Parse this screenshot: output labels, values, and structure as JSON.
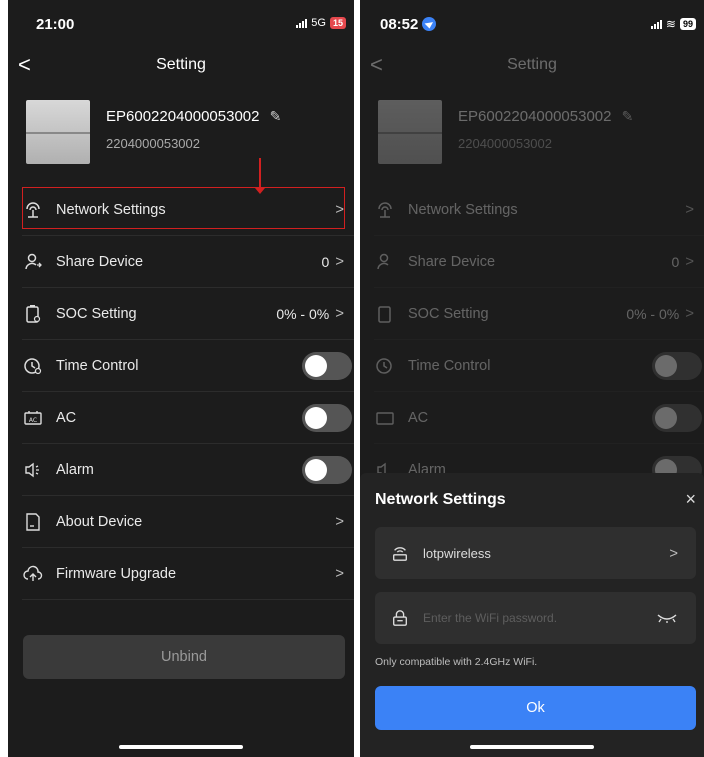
{
  "left": {
    "status": {
      "time": "21:00",
      "network": "5G",
      "battery": "15"
    },
    "nav": {
      "title": "Setting",
      "back": "<"
    },
    "device": {
      "name": "EP6002204000053002",
      "serial": "2204000053002"
    },
    "rows": [
      {
        "label": "Network Settings",
        "value": "",
        "type": "chevron"
      },
      {
        "label": "Share Device",
        "value": "0",
        "type": "chevron"
      },
      {
        "label": "SOC Setting",
        "value": "0% - 0%",
        "type": "chevron"
      },
      {
        "label": "Time Control",
        "value": "",
        "type": "toggle"
      },
      {
        "label": "AC",
        "value": "",
        "type": "toggle"
      },
      {
        "label": "Alarm",
        "value": "",
        "type": "toggle"
      },
      {
        "label": "About Device",
        "value": "",
        "type": "chevron"
      },
      {
        "label": "Firmware Upgrade",
        "value": "",
        "type": "chevron"
      }
    ],
    "unbind": "Unbind",
    "chevron": ">"
  },
  "right": {
    "status": {
      "time": "08:52",
      "battery": "99"
    },
    "nav": {
      "title": "Setting",
      "back": "<"
    },
    "device": {
      "name": "EP6002204000053002",
      "serial": "2204000053002"
    },
    "rows": [
      {
        "label": "Network Settings",
        "value": ""
      },
      {
        "label": "Share Device",
        "value": "0"
      },
      {
        "label": "SOC Setting",
        "value": "0% - 0%"
      },
      {
        "label": "Time Control",
        "value": ""
      },
      {
        "label": "AC",
        "value": ""
      },
      {
        "label": "Alarm",
        "value": ""
      }
    ],
    "sheet": {
      "title": "Network Settings",
      "close": "×",
      "wifi_name": "lotpwireless",
      "password_placeholder": "Enter the WiFi password.",
      "note": "Only compatible with 2.4GHz WiFi.",
      "ok": "Ok"
    },
    "chevron": ">"
  },
  "colors": {
    "accent": "#3b82f6",
    "highlight": "#d12020",
    "background": "#1c1c1c"
  }
}
